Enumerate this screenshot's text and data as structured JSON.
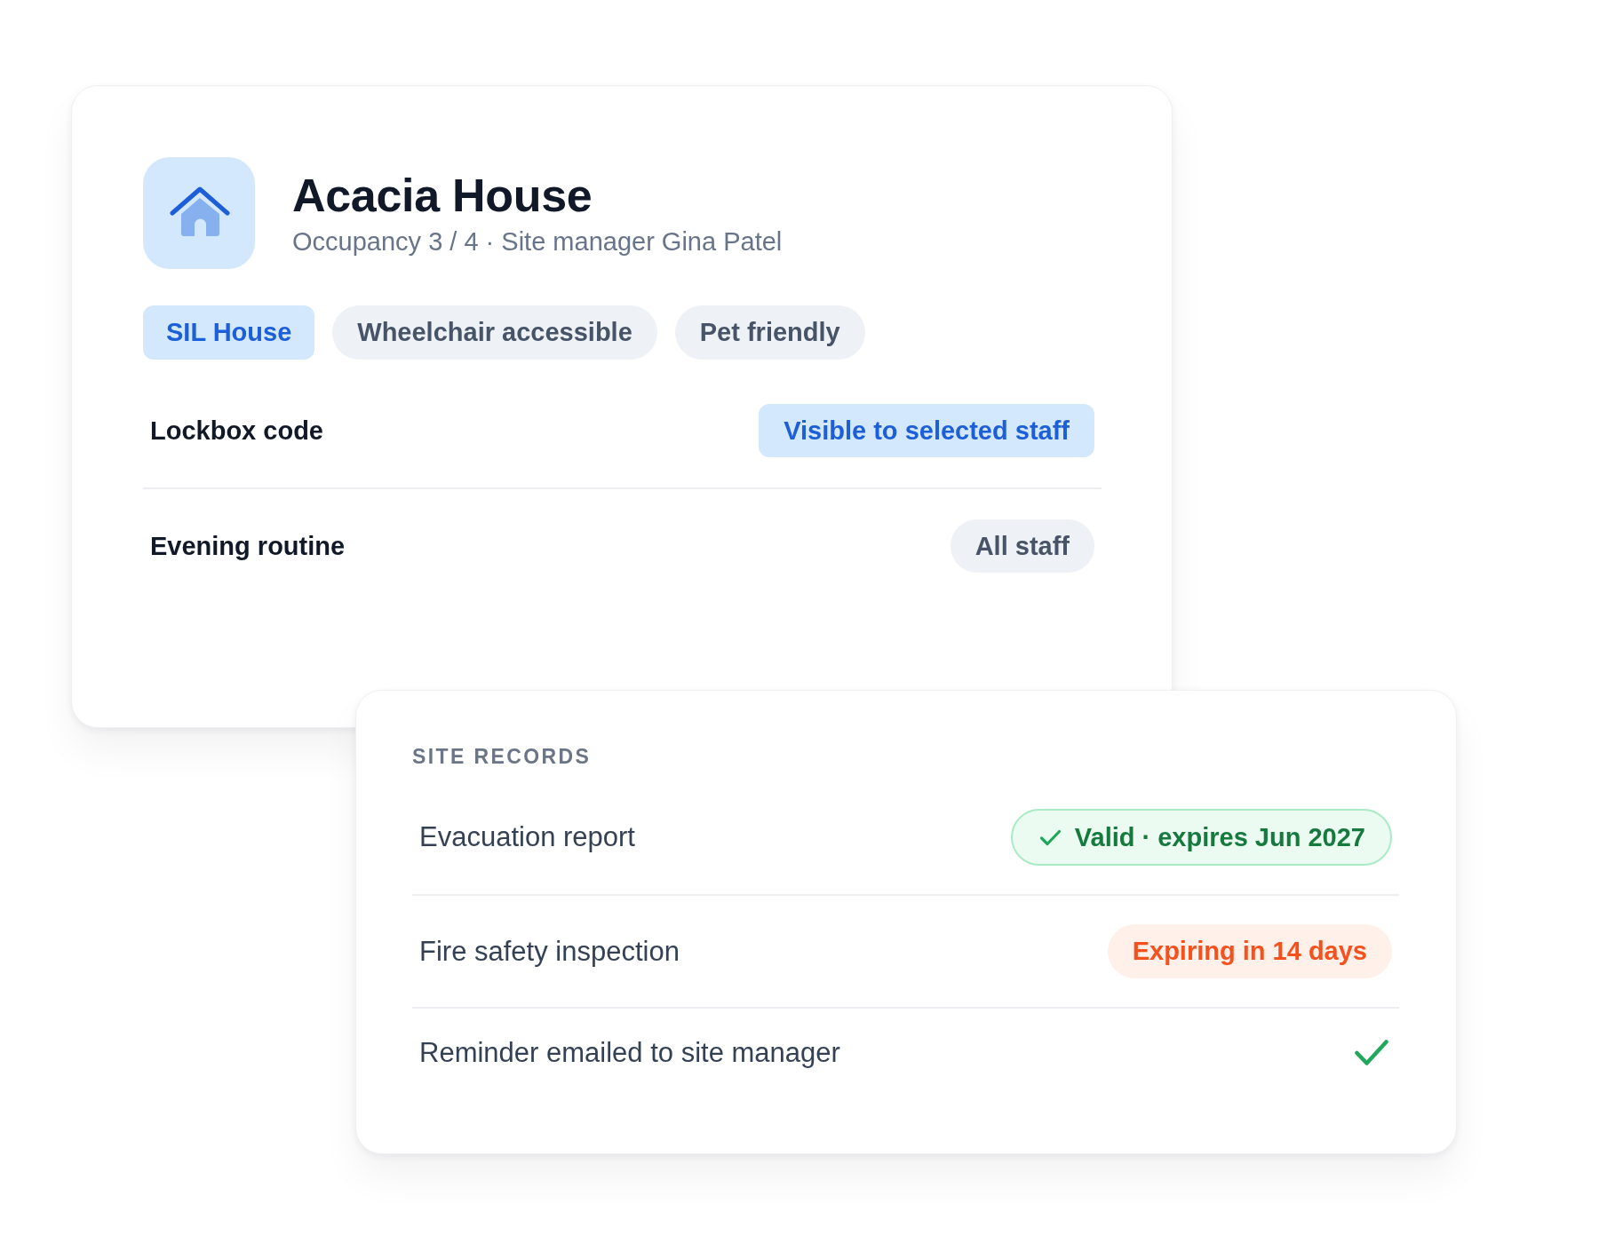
{
  "property": {
    "title": "Acacia House",
    "subtitle": "Occupancy 3 / 4 · Site manager Gina Patel",
    "tags": [
      {
        "label": "SIL House",
        "kind": "primary"
      },
      {
        "label": "Wheelchair accessible",
        "kind": "neutral"
      },
      {
        "label": "Pet friendly",
        "kind": "neutral"
      }
    ],
    "fields": [
      {
        "label": "Lockbox code",
        "visibility": "Visible to selected staff",
        "kind": "restricted"
      },
      {
        "label": "Evening routine",
        "visibility": "All staff",
        "kind": "everyone"
      }
    ]
  },
  "site_records": {
    "heading": "SITE RECORDS",
    "records": [
      {
        "name": "Evacuation report",
        "status": "Valid · expires Jun 2027",
        "kind": "valid"
      },
      {
        "name": "Fire safety inspection",
        "status": "Expiring in 14 days",
        "kind": "expiring"
      },
      {
        "name": "Reminder emailed to site manager",
        "kind": "done"
      }
    ]
  }
}
